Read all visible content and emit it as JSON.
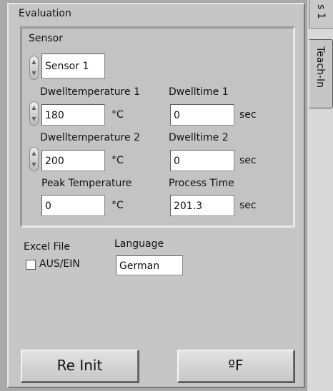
{
  "tabs": {
    "evaluation_label": "Evaluation",
    "top_partial_label": "s 1",
    "teach_in_label": "Teach-In"
  },
  "sensor": {
    "group_label": "Sensor",
    "value": "Sensor 1"
  },
  "dwell_temperature_1": {
    "label": "Dwelltemperature 1",
    "value": "180",
    "unit": "°C"
  },
  "dwell_time_1": {
    "label": "Dwelltime 1",
    "value": "0",
    "unit": "sec"
  },
  "dwell_temperature_2": {
    "label": "Dwelltemperature 2",
    "value": "200",
    "unit": "°C"
  },
  "dwell_time_2": {
    "label": "Dwelltime 2",
    "value": "0",
    "unit": "sec"
  },
  "peak_temperature": {
    "label": "Peak Temperature",
    "value": "0",
    "unit": "°C"
  },
  "process_time": {
    "label": "Process Time",
    "value": "201.3",
    "unit": "sec"
  },
  "excel_file": {
    "label": "Excel File",
    "checkbox_label": "AUS/EIN",
    "checked": false
  },
  "language": {
    "label": "Language",
    "value": "German"
  },
  "buttons": {
    "reinit": "Re Init",
    "unit_toggle": "ºF"
  },
  "icons": [
    "spin-up-icon",
    "spin-down-icon"
  ]
}
